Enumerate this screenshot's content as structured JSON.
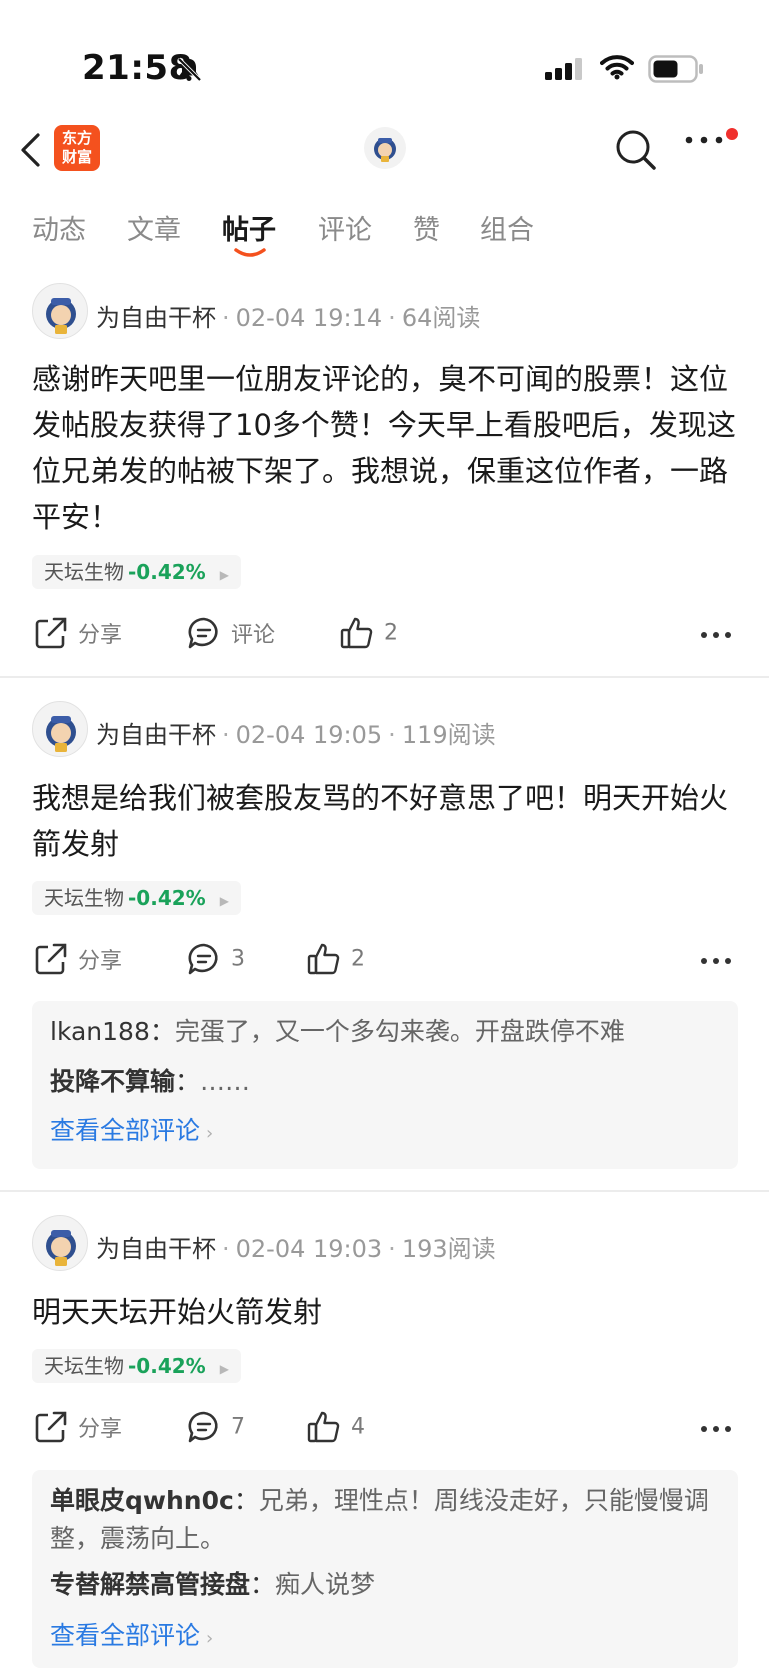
{
  "status": {
    "time": "21:58"
  },
  "app_logo": {
    "line1": "东方",
    "line2": "财富"
  },
  "tabs": [
    {
      "label": "动态",
      "active": false
    },
    {
      "label": "文章",
      "active": false
    },
    {
      "label": "帖子",
      "active": true
    },
    {
      "label": "评论",
      "active": false
    },
    {
      "label": "赞",
      "active": false
    },
    {
      "label": "组合",
      "active": false
    }
  ],
  "colors": {
    "accent": "#f4511e",
    "stock_up": "#1aa25a",
    "link": "#2a7ae2",
    "notification_dot": "#f0302d"
  },
  "posts": [
    {
      "author": "为自由干杯",
      "date": "02-04 19:14",
      "reads": "64阅读",
      "content": "感谢昨天吧里一位朋友评论的，臭不可闻的股票！这位发帖股友获得了10多个赞！今天早上看股吧后，发现这位兄弟发的帖被下架了。我想说，保重这位作者，一路平安！",
      "stock_name": "天坛生物",
      "stock_change": "-0.42%",
      "share_label": "分享",
      "comment_label": "评论",
      "like_count": "2"
    },
    {
      "author": "为自由干杯",
      "date": "02-04 19:05",
      "reads": "119阅读",
      "content": "我想是给我们被套股友骂的不好意思了吧！明天开始火箭发射",
      "stock_name": "天坛生物",
      "stock_change": "-0.42%",
      "share_label": "分享",
      "comment_label": "3",
      "like_count": "2",
      "comments": [
        {
          "name": "lkan188",
          "sep": "：",
          "text": "完蛋了，又一个多勾来袭。开盘跌停不难"
        },
        {
          "name": "投降不算输",
          "sep": "：",
          "text": "……"
        }
      ],
      "view_all": "查看全部评论"
    },
    {
      "author": "为自由干杯",
      "date": "02-04 19:03",
      "reads": "193阅读",
      "content": "明天天坛开始火箭发射",
      "stock_name": "天坛生物",
      "stock_change": "-0.42%",
      "share_label": "分享",
      "comment_label": "7",
      "like_count": "4",
      "comments": [
        {
          "name": "单眼皮qwhn0c",
          "sep": "：",
          "text": "兄弟，理性点！周线没走好，只能慢慢调整，震荡向上。"
        },
        {
          "name": "专替解禁高管接盘",
          "sep": "：",
          "text": "痴人说梦"
        }
      ],
      "view_all": "查看全部评论"
    }
  ]
}
